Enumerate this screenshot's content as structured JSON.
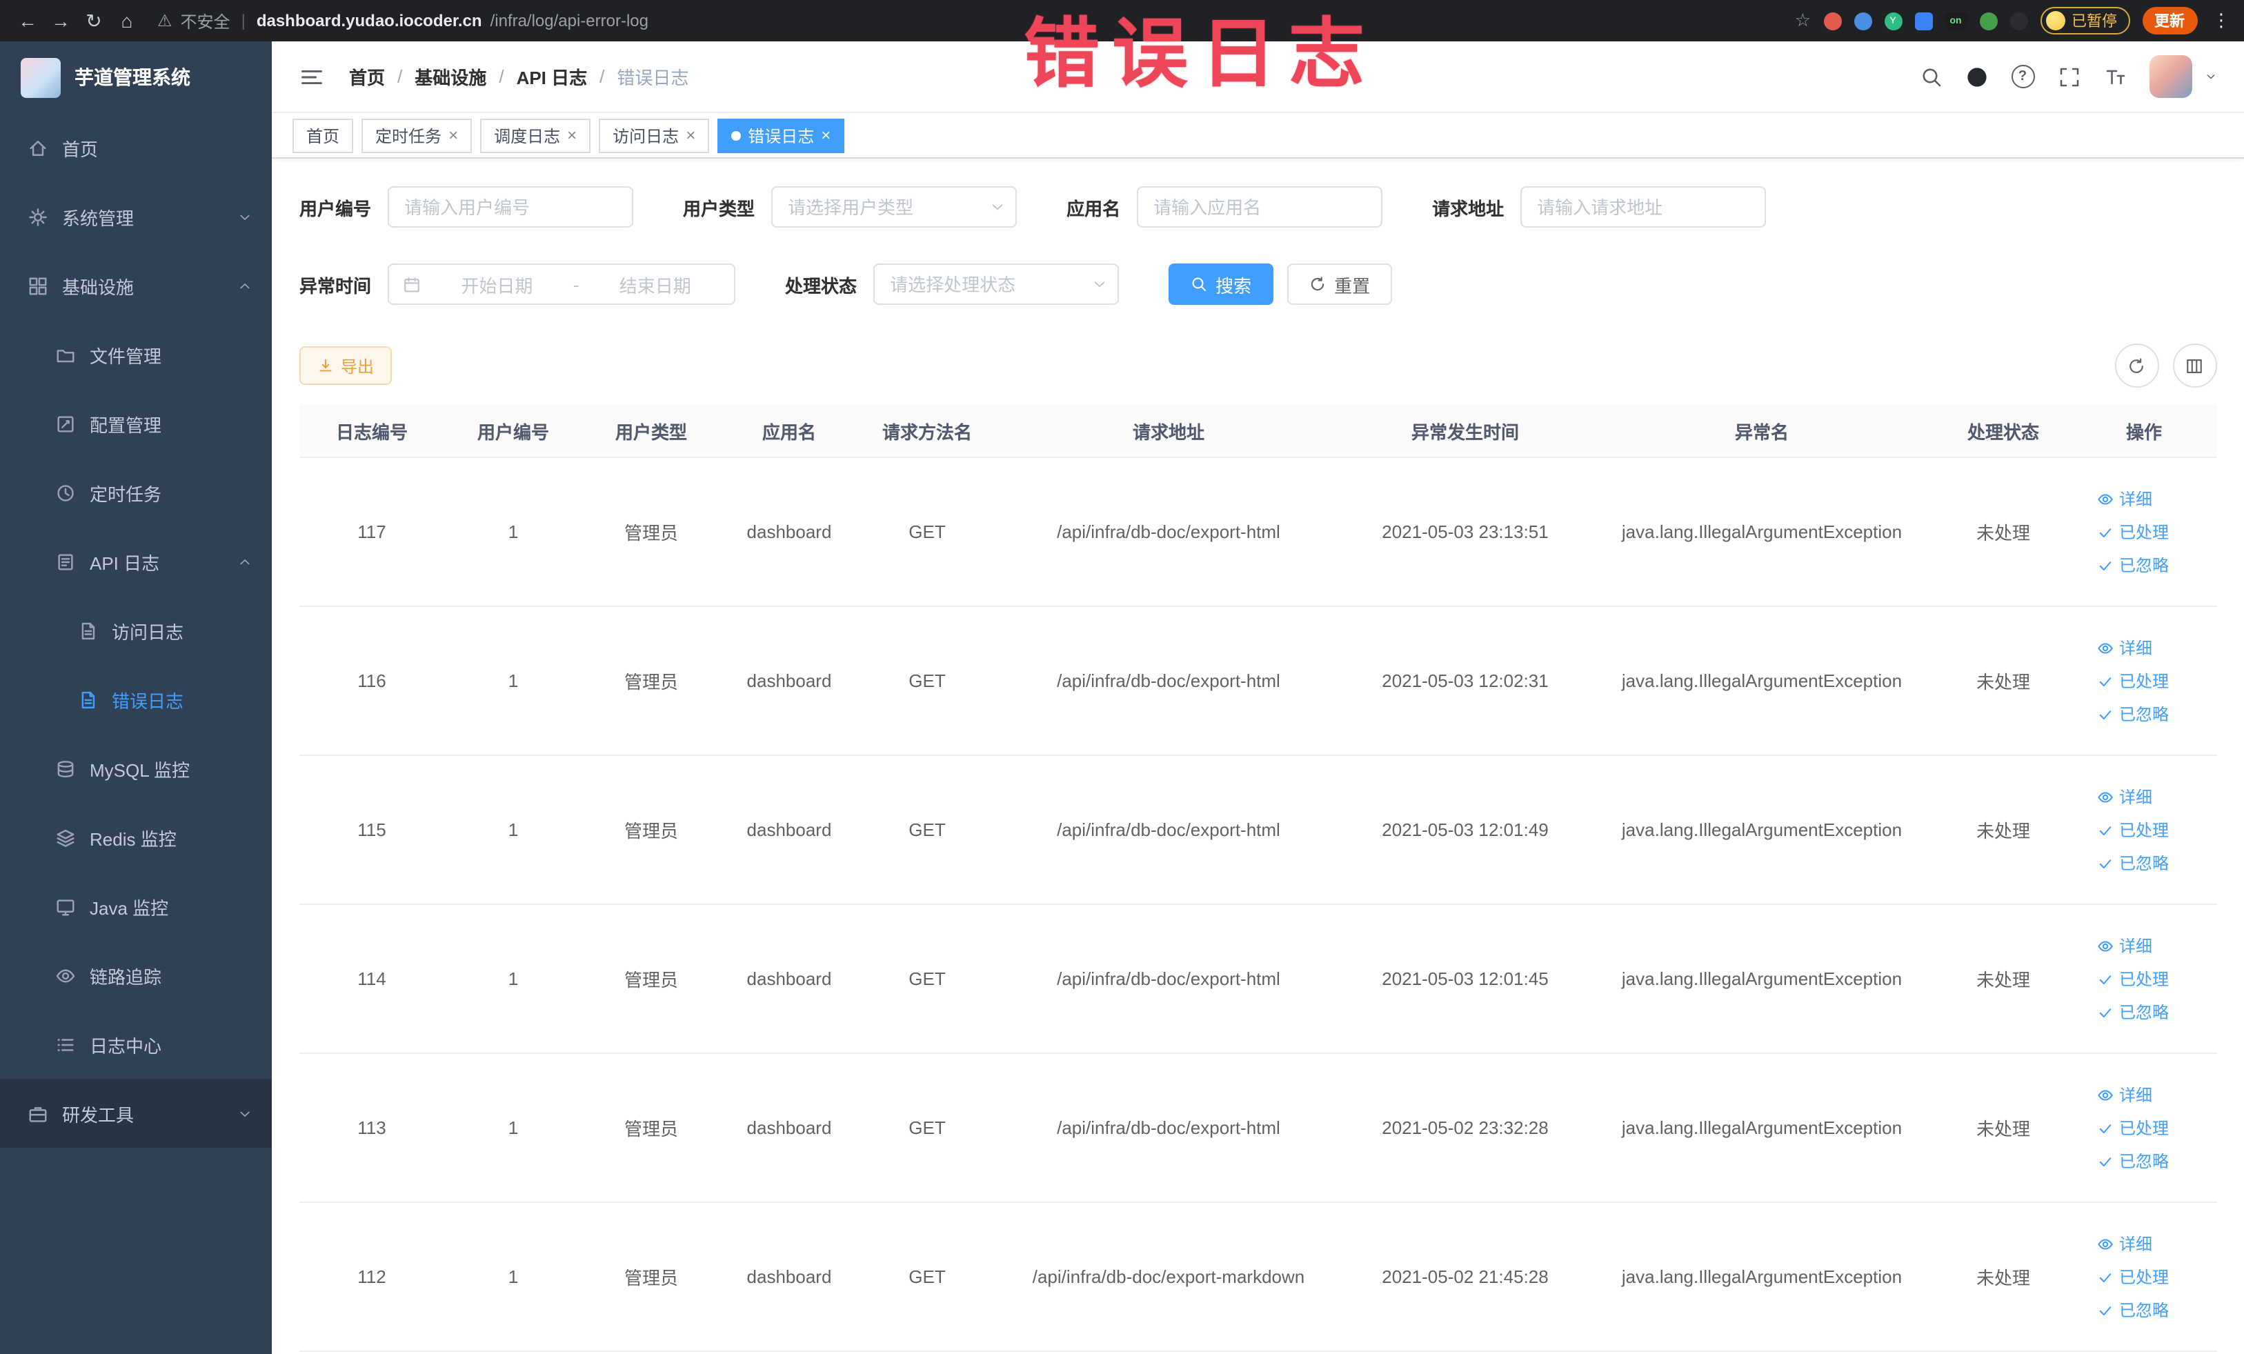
{
  "colors": {
    "accent": "#409eff",
    "sidebar_bg": "#304156",
    "annotation_red": "#ee4558",
    "warning_orange": "#e6a23c",
    "chrome_bg": "#202124"
  },
  "browser": {
    "security_warning": "不安全",
    "url_domain": "dashboard.yudao.iocoder.cn",
    "url_path": "/infra/log/api-error-log",
    "extension_on_label": "on",
    "paused_badge": "已暂停",
    "update_button": "更新"
  },
  "annotation": {
    "text": "错误日志"
  },
  "sidebar": {
    "logo_title": "芋道管理系统",
    "items": [
      {
        "label": "首页"
      },
      {
        "label": "系统管理"
      },
      {
        "label": "基础设施"
      },
      {
        "label": "文件管理"
      },
      {
        "label": "配置管理"
      },
      {
        "label": "定时任务"
      },
      {
        "label": "API 日志"
      },
      {
        "label": "访问日志"
      },
      {
        "label": "错误日志"
      },
      {
        "label": "MySQL 监控"
      },
      {
        "label": "Redis 监控"
      },
      {
        "label": "Java 监控"
      },
      {
        "label": "链路追踪"
      },
      {
        "label": "日志中心"
      },
      {
        "label": "研发工具"
      }
    ]
  },
  "header": {
    "breadcrumb": [
      "首页",
      "基础设施",
      "API 日志",
      "错误日志"
    ]
  },
  "tabs": [
    {
      "label": "首页"
    },
    {
      "label": "定时任务"
    },
    {
      "label": "调度日志"
    },
    {
      "label": "访问日志"
    },
    {
      "label": "错误日志"
    }
  ],
  "filters": {
    "user_id_label": "用户编号",
    "user_id_placeholder": "请输入用户编号",
    "user_type_label": "用户类型",
    "user_type_placeholder": "请选择用户类型",
    "app_name_label": "应用名",
    "app_name_placeholder": "请输入应用名",
    "request_url_label": "请求地址",
    "request_url_placeholder": "请输入请求地址",
    "exception_time_label": "异常时间",
    "start_date_placeholder": "开始日期",
    "range_separator": "-",
    "end_date_placeholder": "结束日期",
    "process_status_label": "处理状态",
    "process_status_placeholder": "请选择处理状态",
    "search_button": "搜索",
    "reset_button": "重置"
  },
  "toolbar": {
    "export_button": "导出"
  },
  "table": {
    "headers": [
      "日志编号",
      "用户编号",
      "用户类型",
      "应用名",
      "请求方法名",
      "请求地址",
      "异常发生时间",
      "异常名",
      "处理状态",
      "操作"
    ],
    "action_detail": "详细",
    "action_processed": "已处理",
    "action_ignored": "已忽略",
    "rows": [
      {
        "id": "117",
        "user_id": "1",
        "user_type": "管理员",
        "app": "dashboard",
        "method": "GET",
        "url": "/api/infra/db-doc/export-html",
        "time": "2021-05-03 23:13:51",
        "exception": "java.lang.IllegalArgumentException",
        "status": "未处理"
      },
      {
        "id": "116",
        "user_id": "1",
        "user_type": "管理员",
        "app": "dashboard",
        "method": "GET",
        "url": "/api/infra/db-doc/export-html",
        "time": "2021-05-03 12:02:31",
        "exception": "java.lang.IllegalArgumentException",
        "status": "未处理"
      },
      {
        "id": "115",
        "user_id": "1",
        "user_type": "管理员",
        "app": "dashboard",
        "method": "GET",
        "url": "/api/infra/db-doc/export-html",
        "time": "2021-05-03 12:01:49",
        "exception": "java.lang.IllegalArgumentException",
        "status": "未处理"
      },
      {
        "id": "114",
        "user_id": "1",
        "user_type": "管理员",
        "app": "dashboard",
        "method": "GET",
        "url": "/api/infra/db-doc/export-html",
        "time": "2021-05-03 12:01:45",
        "exception": "java.lang.IllegalArgumentException",
        "status": "未处理"
      },
      {
        "id": "113",
        "user_id": "1",
        "user_type": "管理员",
        "app": "dashboard",
        "method": "GET",
        "url": "/api/infra/db-doc/export-html",
        "time": "2021-05-02 23:32:28",
        "exception": "java.lang.IllegalArgumentException",
        "status": "未处理"
      },
      {
        "id": "112",
        "user_id": "1",
        "user_type": "管理员",
        "app": "dashboard",
        "method": "GET",
        "url": "/api/infra/db-doc/export-markdown",
        "time": "2021-05-02 21:45:28",
        "exception": "java.lang.IllegalArgumentException",
        "status": "未处理"
      }
    ]
  }
}
